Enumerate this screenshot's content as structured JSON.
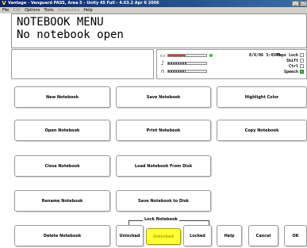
{
  "window": {
    "title": "Vantage - Vanguard PASS, Area 5 - Unity 45 Full - 4.03.2 Apr 6 2006",
    "app_icon": "V",
    "controls": [
      "_",
      "□"
    ]
  },
  "menubar": {
    "items": [
      {
        "label": "File",
        "disabled": false
      },
      {
        "label": "Edit",
        "disabled": true
      },
      {
        "label": "Options",
        "disabled": false
      },
      {
        "label": "Tools",
        "disabled": false
      },
      {
        "label": "Vocabulary",
        "disabled": true
      },
      {
        "label": "Help",
        "disabled": false
      }
    ]
  },
  "message": {
    "line1": "NOTEBOOK MENU",
    "line2": "No notebook open"
  },
  "status": {
    "datetime": "8/8/06 3:45PM",
    "meters": [
      {
        "icon": "battery-icon",
        "glyph": "▭",
        "level_fraction": 0.45,
        "fill_color": "#e23c2c",
        "dot_color": "#2fbf2f"
      },
      {
        "icon": "speaker-icon",
        "glyph": "♪",
        "level_fraction": 0.5,
        "fill_color": "segmented",
        "dot_color": ""
      },
      {
        "icon": "headphones-icon",
        "glyph": "∩",
        "level_fraction": 0.45,
        "fill_color": "segmented",
        "dot_color": ""
      }
    ],
    "locks": [
      {
        "label": "Caps Lock",
        "on": false
      },
      {
        "label": "Shift",
        "on": false
      },
      {
        "label": "Ctrl",
        "on": false
      },
      {
        "label": "Speech",
        "on": true
      }
    ]
  },
  "buttons": {
    "new_notebook": "New Notebook",
    "save_notebook": "Save Notebook",
    "highlight_color": "Highlight Color",
    "open_notebook": "Open Notebook",
    "print_notebook": "Print Notebook",
    "copy_notebook": "Copy Notebook",
    "close_notebook": "Close Notebook",
    "load_notebook_from_disk": "Load Notebook From Disk",
    "rename_notebook": "Rename Notebook",
    "save_notebook_to_disk": "Save Notebook to Disk",
    "delete_notebook": "Delete Notebook",
    "unlocked_1": "Unlocked",
    "unlocked_2": "Unlocked",
    "locked": "Locked",
    "help": "Help",
    "cancel": "Cancel",
    "ok": "OK"
  },
  "lock_group": {
    "title": "Lock Notebook"
  },
  "colors": {
    "selected_button": "#ffff33",
    "speech_indicator": "#3fbf3f"
  }
}
